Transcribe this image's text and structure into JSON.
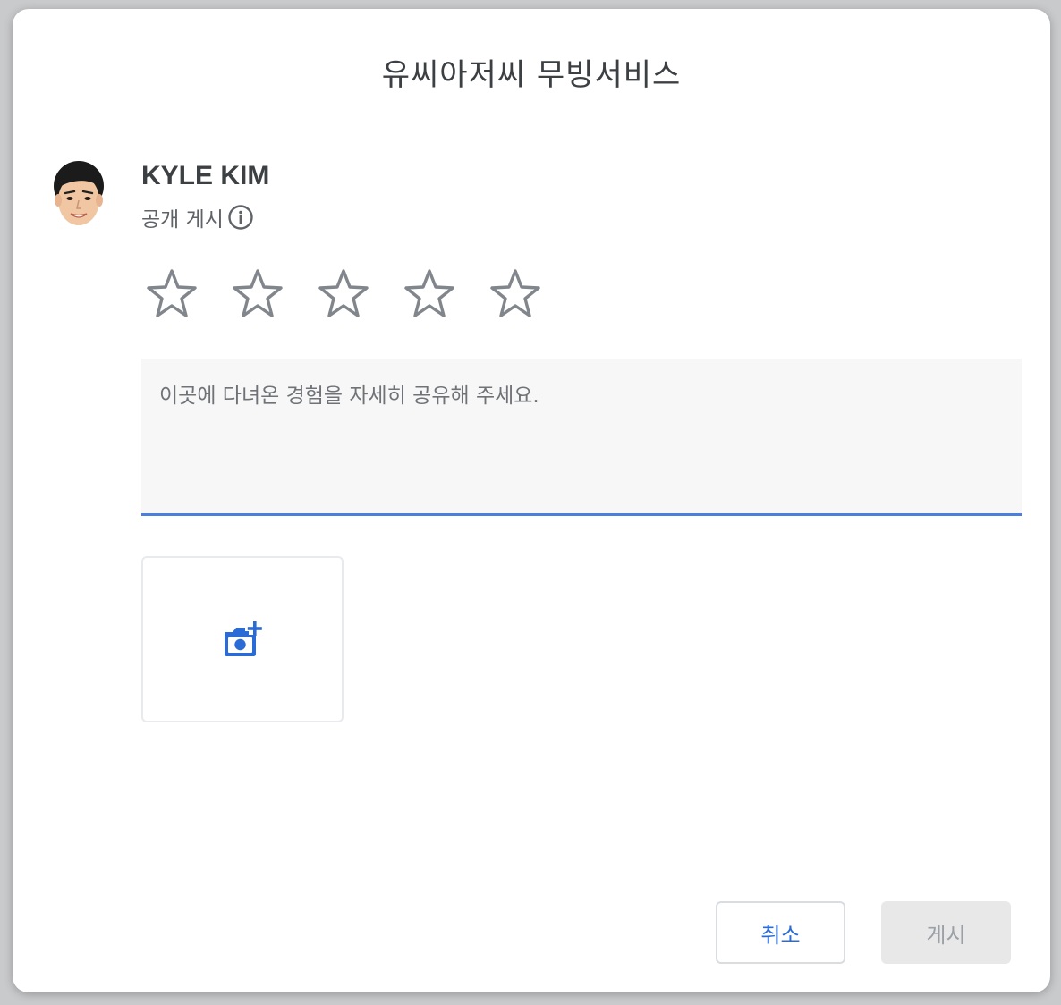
{
  "dialog": {
    "title": "유씨아저씨 무빙서비스"
  },
  "user": {
    "name": "KYLE KIM",
    "visibility_label": "공개 게시",
    "avatar_icon": "avatar-photo",
    "info_icon": "info-icon"
  },
  "rating": {
    "value": 0,
    "max": 5,
    "star_outline_color": "#80868b"
  },
  "review": {
    "value": "",
    "placeholder": "이곳에 다녀온 경험을 자세히 공유해 주세요.",
    "underline_color": "#4a7fde"
  },
  "photo": {
    "icon": "add-photo-icon",
    "icon_color": "#2b6bd6"
  },
  "actions": {
    "cancel_label": "취소",
    "post_label": "게시",
    "accent_color": "#2b6bd6"
  }
}
